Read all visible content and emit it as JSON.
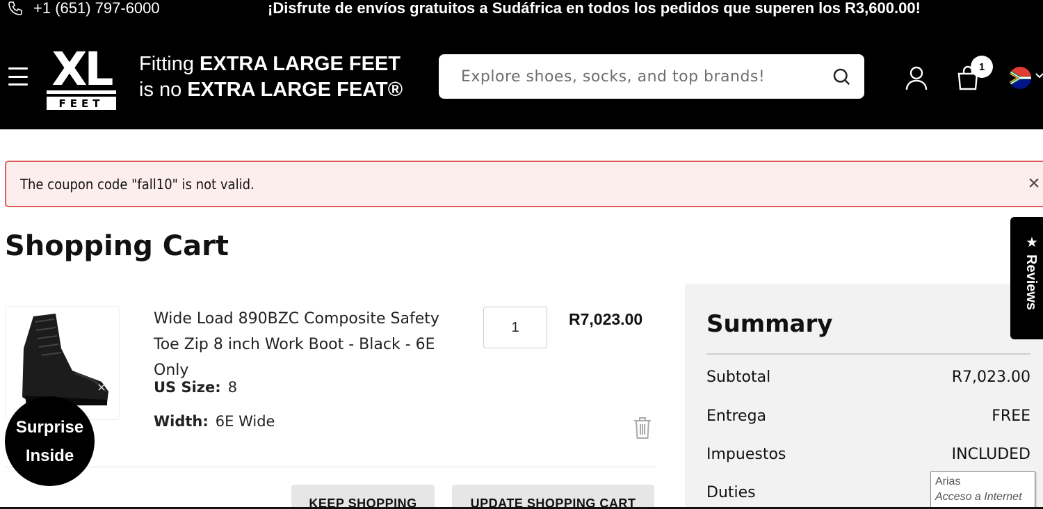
{
  "topbar": {
    "phone": "+1 (651) 797-6000",
    "promo": "¡Disfrute de envíos gratuitos a Sudáfrica en todos los pedidos que superen los R3,600.00!"
  },
  "header": {
    "logo_text": "XL FEET",
    "tagline_line1_prefix": "Fitting ",
    "tagline_line1_bold": "EXTRA LARGE FEET",
    "tagline_line2_prefix": "is no ",
    "tagline_line2_bold": "EXTRA LARGE FEAT®",
    "search_placeholder": "Explore shoes, socks, and top brands!",
    "cart_count": "1",
    "country_flag": "south-africa-flag"
  },
  "alert": {
    "message": "The coupon code \"fall10\" is not valid.",
    "close_symbol": "×"
  },
  "page": {
    "title": "Shopping Cart"
  },
  "cart": {
    "items": [
      {
        "name": "Wide Load 890BZC Composite Safety Toe Zip 8 inch Work Boot - Black - 6E Only",
        "size_label": "US Size:",
        "size_value": "8",
        "width_label": "Width:",
        "width_value": "6E Wide",
        "quantity": "1",
        "price": "R7,023.00"
      }
    ],
    "keep_shopping": "KEEP SHOPPING",
    "update_cart": "UPDATE SHOPPING CART"
  },
  "promo_badge": {
    "line1": "Surprise",
    "line2": "Inside"
  },
  "summary": {
    "title": "Summary",
    "rows": [
      {
        "label": "Subtotal",
        "value": "R7,023.00"
      },
      {
        "label": "Entrega",
        "value": "FREE"
      },
      {
        "label": "Impuestos",
        "value": "INCLUDED"
      },
      {
        "label": "Duties",
        "value": ""
      }
    ]
  },
  "reviews_tab": {
    "label": "Reviews",
    "star": "★"
  },
  "tooltip": {
    "line1": "Arias",
    "line2": "Acceso a Internet"
  },
  "colors": {
    "header_bg": "#000000",
    "alert_border": "#e05a5a",
    "alert_bg": "#fdeeee",
    "summary_bg": "#f2f2f2",
    "button_bg": "#e6e6e6"
  }
}
